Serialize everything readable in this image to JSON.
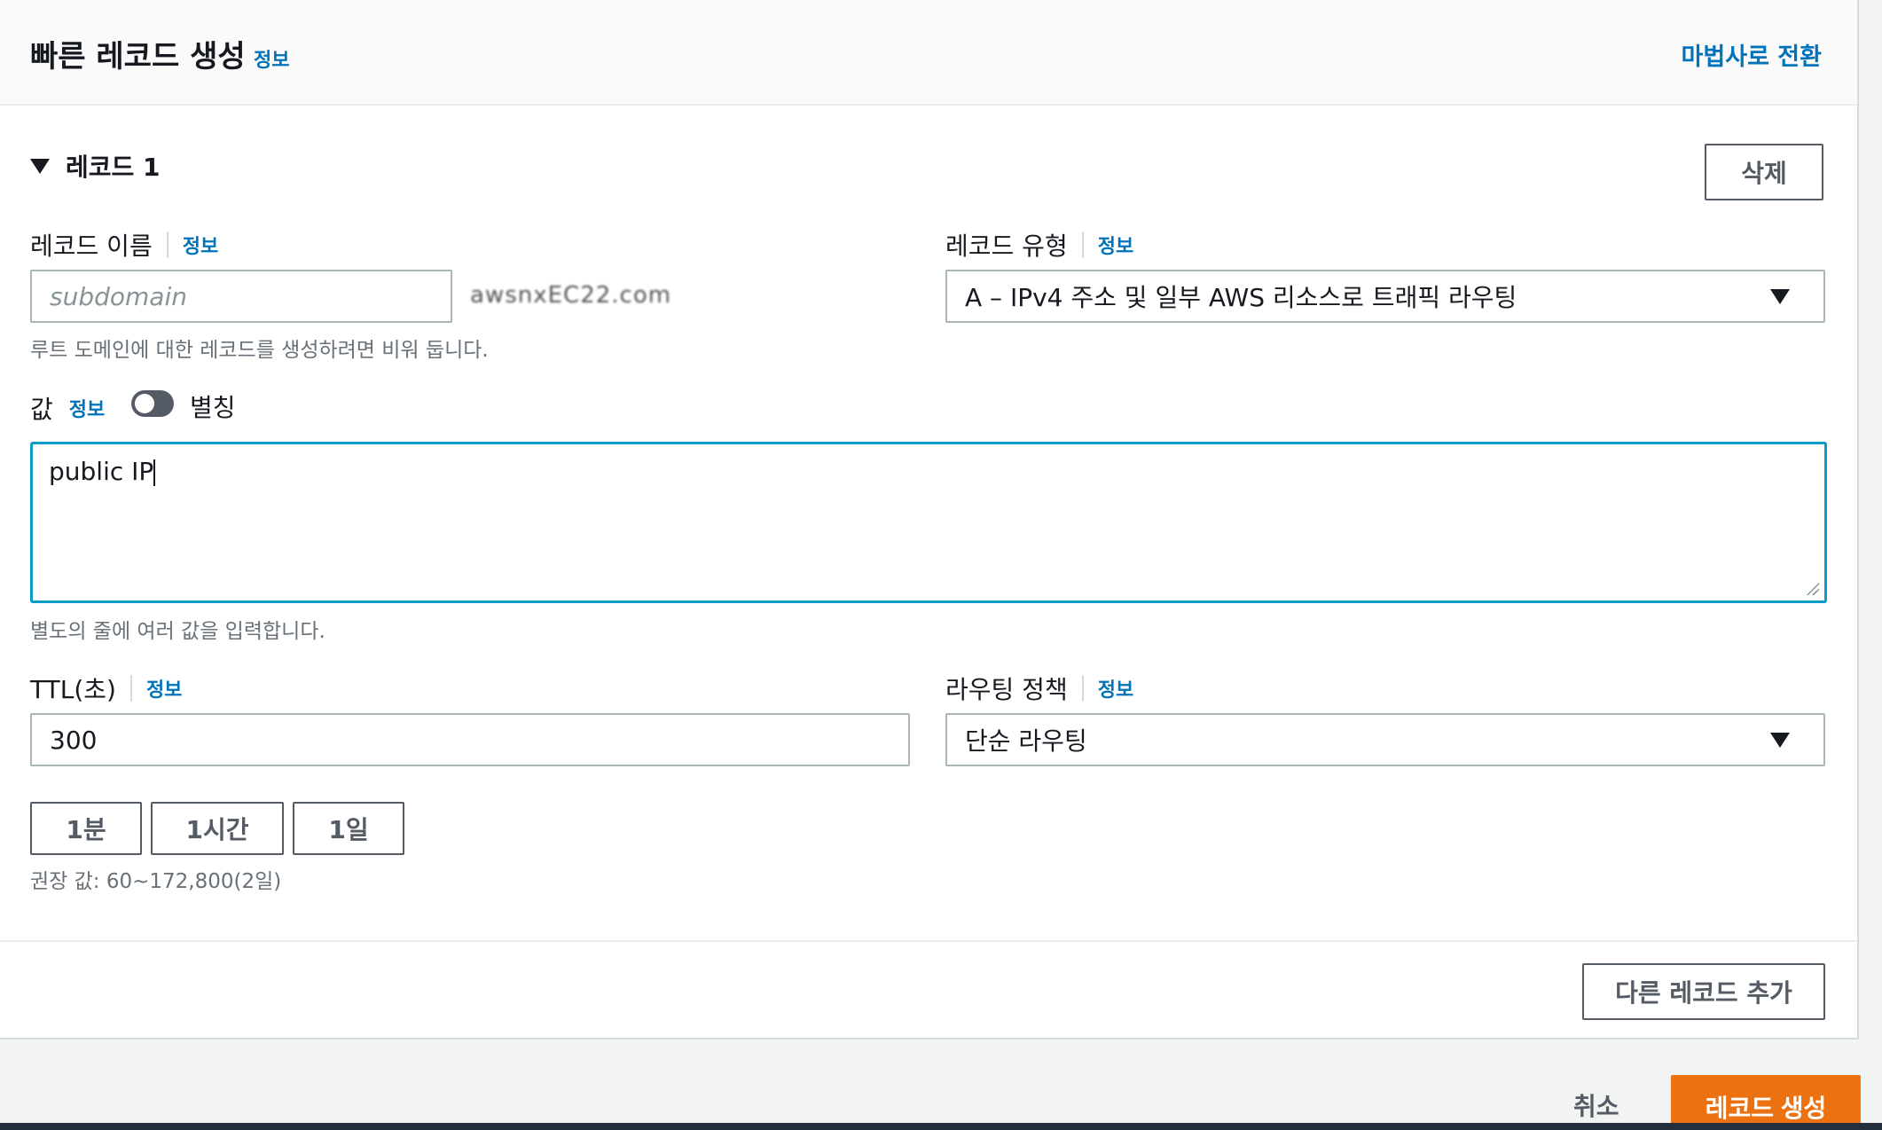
{
  "header": {
    "title": "빠른 레코드 생성",
    "info": "정보",
    "wizard_link": "마법사로 전환"
  },
  "record": {
    "section_label": "레코드 1",
    "delete_button": "삭제",
    "name": {
      "label": "레코드 이름",
      "info": "정보",
      "placeholder": "subdomain",
      "value": "",
      "domain_suffix": "awsnxEC22.com",
      "hint": "루트 도메인에 대한 레코드를 생성하려면 비워 둡니다."
    },
    "type": {
      "label": "레코드 유형",
      "info": "정보",
      "selected": "A – IPv4 주소 및 일부 AWS 리소스로 트래픽 라우팅"
    },
    "value": {
      "label": "값",
      "info": "정보",
      "alias_toggle_label": "별칭",
      "alias_enabled": false,
      "text": "public IP",
      "hint": "별도의 줄에 여러 값을 입력합니다."
    },
    "ttl": {
      "label": "TTL(초)",
      "info": "정보",
      "value": "300",
      "presets": [
        "1분",
        "1시간",
        "1일"
      ],
      "hint": "권장 값: 60~172,800(2일)"
    },
    "routing": {
      "label": "라우팅 정책",
      "info": "정보",
      "selected": "단순 라우팅"
    }
  },
  "footer": {
    "add_record": "다른 레코드 추가",
    "cancel": "취소",
    "create": "레코드 생성"
  },
  "colors": {
    "accent": "#ec7211",
    "link": "#0073bb",
    "focus_border": "#0a9cc8"
  }
}
